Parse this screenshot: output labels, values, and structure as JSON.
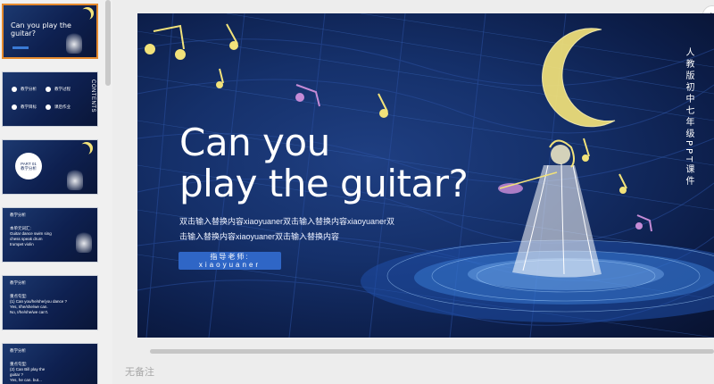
{
  "thumbnails": [
    {
      "title": "Can you\nplay the guitar?"
    },
    {
      "side": "CONTENTS",
      "items": [
        "教学分析",
        "教学过程",
        "教学目标",
        "课后作业"
      ]
    },
    {
      "circle_text": "PART 01\n教学分析"
    },
    {
      "heading": "教学分析",
      "body": "本单元词汇:\nGuitar  dance  swim  sing\nchess  speak  drum\ntrumpet  violin"
    },
    {
      "heading": "教学分析",
      "body": "重点句型:\n(1) Can you/he/she/you dance ?\n    Yes,  I/he/she/we can.\n    No,  I/he/she/we can't."
    },
    {
      "heading": "教学分析",
      "body": "重点句型:\n(2) Can Bill play the\n    guitar ?\n    Yes,  he can.  but..."
    }
  ],
  "slide": {
    "title": "Can you\nplay the guitar?",
    "body": "双击输入替换内容xiaoyuaner双击输入替换内容xiaoyuaner双击输入替换内容xiaoyuaner双击输入替换内容",
    "teacher_label": "指导老师:",
    "teacher_name": "xiaoyuaner",
    "vertical_caption": "人教版初中七年级PPT课件"
  },
  "notes_placeholder": "无备注",
  "colors": {
    "accent": "#e58a2e",
    "button": "#2f66c6",
    "moon": "#f2e27a",
    "slide_bg": "#15306a"
  }
}
